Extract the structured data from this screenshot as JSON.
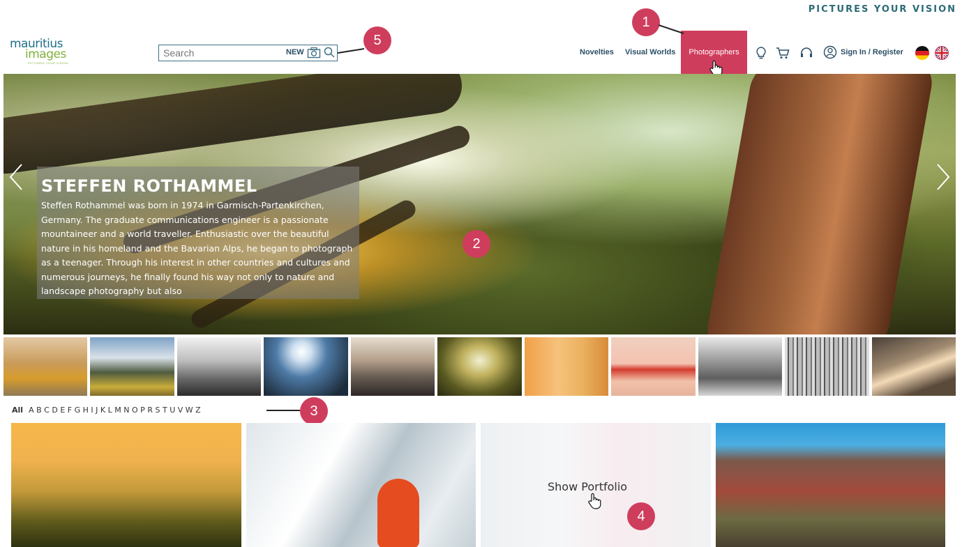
{
  "tagline": "PICTURES YOUR VISION",
  "logo": {
    "line1": "mauritius",
    "line2": "images",
    "line3": "PICTURES YOUR VISION"
  },
  "search": {
    "placeholder": "Search",
    "new_label": "NEW"
  },
  "nav": {
    "novelties": "Novelties",
    "visual_worlds": "Visual Worlds",
    "photographers": "Photographers",
    "signin": "Sign In / Register"
  },
  "icons": [
    "lightbulb-icon",
    "cart-icon",
    "headset-icon",
    "user-icon",
    "german-flag-icon",
    "uk-flag-icon",
    "camera-icon",
    "search-icon",
    "chevron-left-icon",
    "chevron-right-icon",
    "hand-pointer-icon"
  ],
  "hero": {
    "title": "STEFFEN ROTHAMMEL",
    "text": "Steffen Rothammel was born in 1974 in Garmisch-Partenkirchen, Germany. The graduate communications engineer is a passionate mountaineer and a world traveller. Enthusiastic over the beautiful nature in his homeland and the Bavarian Alps, he began to photograph as a teenager. Through his interest in other countries and cultures and numerous journeys, he finally found his way not only to nature and landscape photography but also"
  },
  "alphabet": {
    "all": "All",
    "letters": [
      "A",
      "B",
      "C",
      "D",
      "E",
      "F",
      "G",
      "H",
      "I",
      "J",
      "K",
      "L",
      "M",
      "N",
      "O",
      "P",
      "R",
      "S",
      "T",
      "U",
      "V",
      "W",
      "Z"
    ]
  },
  "gallery": {
    "show_portfolio": "Show Portfolio"
  },
  "callouts": [
    "1",
    "2",
    "3",
    "4",
    "5"
  ],
  "colors": {
    "accent": "#cf3d5d",
    "nav_text": "#2a4f66",
    "brand_blue": "#1f6f86",
    "brand_green": "#7fb13a"
  }
}
